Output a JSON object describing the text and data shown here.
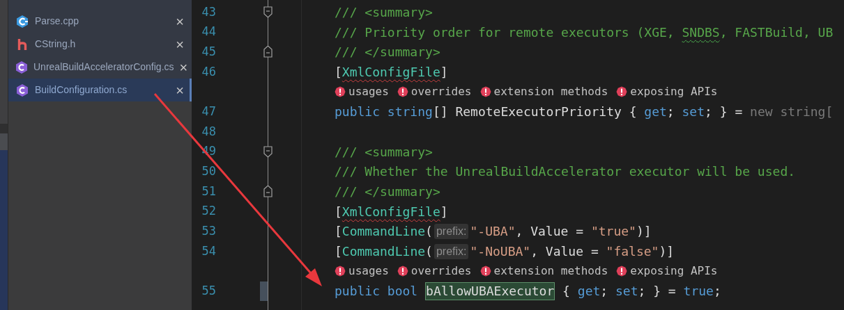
{
  "files": [
    {
      "name": "Parse.cpp",
      "kind": "cpp",
      "selected": false
    },
    {
      "name": "CString.h",
      "kind": "header",
      "selected": false
    },
    {
      "name": "UnrealBuildAcceleratorConfig.cs",
      "kind": "csharp",
      "selected": false
    },
    {
      "name": "BuildConfiguration.cs",
      "kind": "csharp",
      "selected": true
    }
  ],
  "close_glyph": "×",
  "editor": {
    "lines": [
      {
        "kind": "code",
        "number": "43",
        "fold_start": true,
        "tokens": [
          {
            "text": "/// <summary>",
            "kind": "comment"
          }
        ]
      },
      {
        "kind": "code",
        "number": "44",
        "tokens": [
          {
            "text": "/// Priority order for remote executors (XGE, ",
            "kind": "comment"
          },
          {
            "text": "SNDBS",
            "kind": "comment_warning"
          },
          {
            "text": ", FASTBuild, UB",
            "kind": "comment"
          }
        ]
      },
      {
        "kind": "code",
        "number": "45",
        "fold_end": true,
        "tokens": [
          {
            "text": "/// </summary>",
            "kind": "comment"
          }
        ]
      },
      {
        "kind": "code",
        "number": "46",
        "tokens": [
          {
            "text": "[",
            "kind": "plain"
          },
          {
            "text": "XmlConfigFile",
            "kind": "type_error"
          },
          {
            "text": "]",
            "kind": "plain"
          }
        ]
      },
      {
        "kind": "hints",
        "items": [
          "usages",
          "overrides",
          "extension methods",
          "exposing APIs"
        ]
      },
      {
        "kind": "code",
        "number": "47",
        "tokens": [
          {
            "text": "public string",
            "kind": "keyword"
          },
          {
            "text": "[] RemoteExecutorPriority { ",
            "kind": "plain"
          },
          {
            "text": "get",
            "kind": "keyword"
          },
          {
            "text": "; ",
            "kind": "plain"
          },
          {
            "text": "set",
            "kind": "keyword"
          },
          {
            "text": "; } = ",
            "kind": "plain"
          },
          {
            "text": "new string[",
            "kind": "dim"
          }
        ]
      },
      {
        "kind": "code",
        "number": "48"
      },
      {
        "kind": "code",
        "number": "49",
        "fold_start": true,
        "tokens": [
          {
            "text": "/// <summary>",
            "kind": "comment"
          }
        ]
      },
      {
        "kind": "code",
        "number": "50",
        "tokens": [
          {
            "text": "/// Whether the UnrealBuildAccelerator executor will be used.",
            "kind": "comment"
          }
        ]
      },
      {
        "kind": "code",
        "number": "51",
        "fold_end": true,
        "tokens": [
          {
            "text": "/// </summary>",
            "kind": "comment"
          }
        ]
      },
      {
        "kind": "code",
        "number": "52",
        "tokens": [
          {
            "text": "[",
            "kind": "plain"
          },
          {
            "text": "XmlConfigFile",
            "kind": "type_error"
          },
          {
            "text": "]",
            "kind": "plain"
          }
        ]
      },
      {
        "kind": "code",
        "number": "53",
        "tokens": [
          {
            "text": "[",
            "kind": "plain"
          },
          {
            "text": "CommandLine",
            "kind": "type"
          },
          {
            "text": "(",
            "kind": "plain"
          },
          {
            "text": "prefix:",
            "kind": "param_hint"
          },
          {
            "text": "\"-UBA\"",
            "kind": "string"
          },
          {
            "text": ", Value = ",
            "kind": "plain"
          },
          {
            "text": "\"true\"",
            "kind": "string"
          },
          {
            "text": ")]",
            "kind": "plain"
          }
        ]
      },
      {
        "kind": "code",
        "number": "54",
        "tokens": [
          {
            "text": "[",
            "kind": "plain"
          },
          {
            "text": "CommandLine",
            "kind": "type"
          },
          {
            "text": "(",
            "kind": "plain"
          },
          {
            "text": "prefix:",
            "kind": "param_hint"
          },
          {
            "text": "\"-NoUBA\"",
            "kind": "string"
          },
          {
            "text": ", Value = ",
            "kind": "plain"
          },
          {
            "text": "\"false\"",
            "kind": "string"
          },
          {
            "text": ")]",
            "kind": "plain"
          }
        ]
      },
      {
        "kind": "hints",
        "items": [
          "usages",
          "overrides",
          "extension methods",
          "exposing APIs"
        ]
      },
      {
        "kind": "code",
        "number": "55",
        "marker": true,
        "tokens": [
          {
            "text": "public bool ",
            "kind": "keyword"
          },
          {
            "text": "bAllowUBAExecutor",
            "kind": "highlight"
          },
          {
            "text": " { ",
            "kind": "plain"
          },
          {
            "text": "get",
            "kind": "keyword"
          },
          {
            "text": "; ",
            "kind": "plain"
          },
          {
            "text": "set",
            "kind": "keyword"
          },
          {
            "text": "; } = ",
            "kind": "plain"
          },
          {
            "text": "true",
            "kind": "keyword"
          },
          {
            "text": ";",
            "kind": "plain"
          }
        ]
      }
    ]
  }
}
